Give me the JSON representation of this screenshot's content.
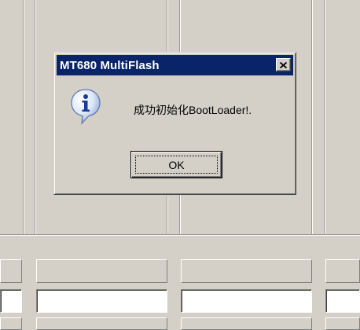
{
  "dialog": {
    "title": "MT680 MultiFlash",
    "close_icon": "close-icon",
    "info_icon": "information-icon",
    "message": "成功初始化BootLoader!.",
    "ok_label": "OK"
  },
  "colors": {
    "title_bar": "#0a246a",
    "title_text": "#ffffff",
    "window_bg": "#d4d0c8"
  }
}
